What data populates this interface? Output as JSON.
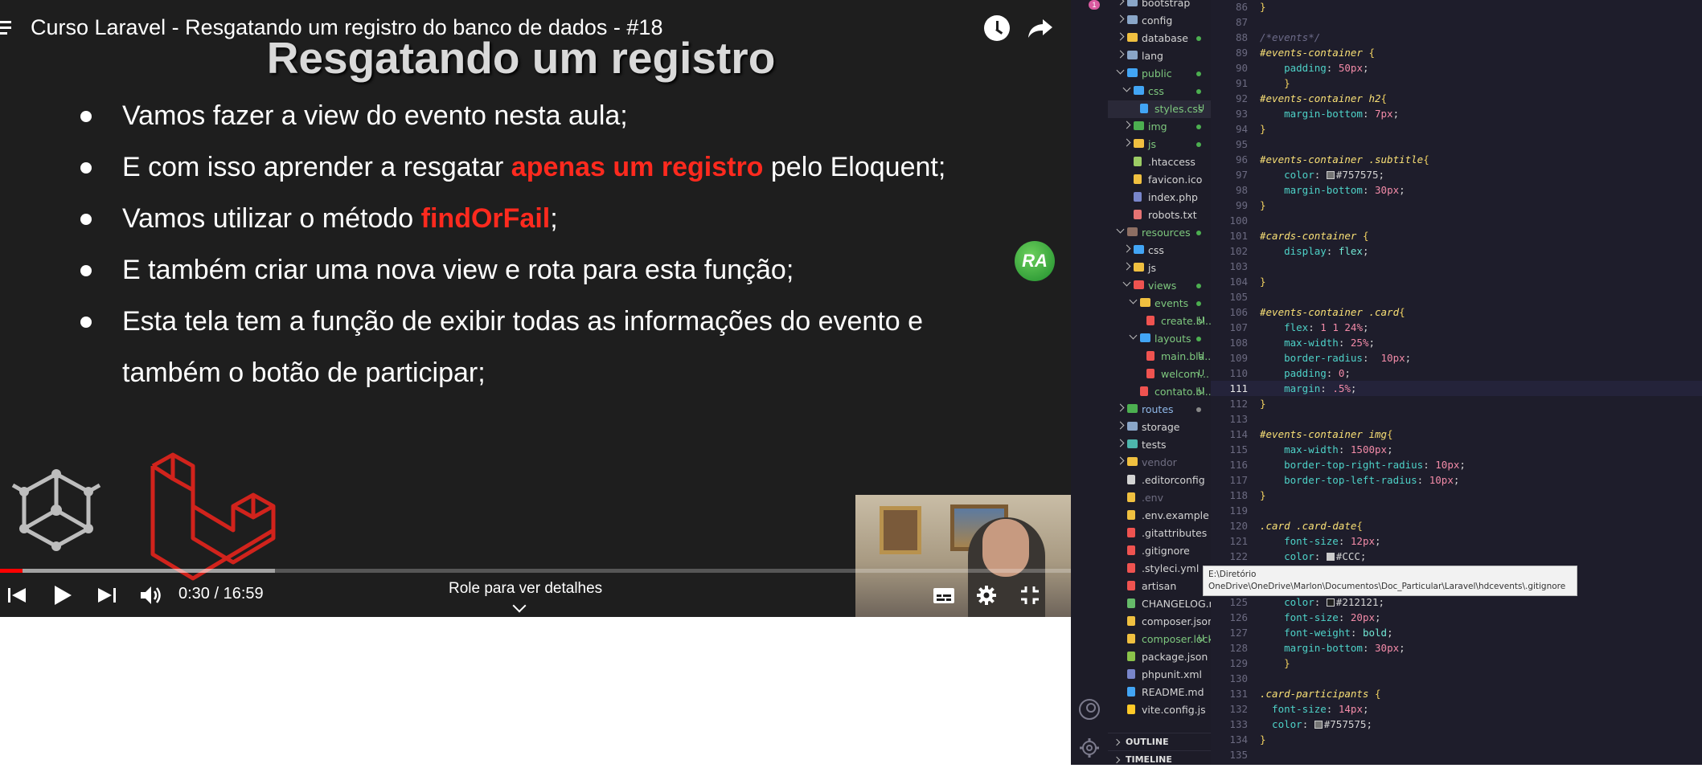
{
  "player": {
    "title": "Curso Laravel - Resgatando um registro do banco de dados - #18",
    "slide": {
      "heading": "Resgatando um registro",
      "bullets": [
        {
          "text": "Vamos fazer a view do evento nesta aula;"
        },
        {
          "before": "E com isso aprender a resgatar ",
          "highlight": "apenas um registro",
          "after": " pelo Eloquent;"
        },
        {
          "before": "Vamos utilizar o método ",
          "highlight": "findOrFail",
          "after": ";"
        },
        {
          "text": "E também criar uma nova view e rota para esta função;"
        },
        {
          "line1": "Esta tela tem a função de exibir todas as informações do evento e",
          "line2": "também o botão de participar;"
        }
      ],
      "highlight_color": "#ff2a1e"
    },
    "channel_badge": "RA",
    "progress": {
      "played_fraction": 0.021,
      "buffered_fraction": 0.257,
      "played_color": "#ff0000"
    },
    "time": "0:30 / 16:59",
    "details_hint": "Role para ver detalhes",
    "icons": [
      "menu-icon",
      "watch-later-icon",
      "share-icon",
      "previous-icon",
      "play-icon",
      "next-icon",
      "volume-icon",
      "captions-icon",
      "settings-icon",
      "exit-fullscreen-icon"
    ]
  },
  "vscode": {
    "activity_badge": "1",
    "explorer": [
      {
        "name": "bootstrap",
        "type": "folder",
        "chev": "right",
        "color": "#8aa6c8",
        "indent": 1
      },
      {
        "name": "config",
        "type": "folder",
        "chev": "right",
        "color": "#8aa6c8",
        "indent": 1
      },
      {
        "name": "database",
        "type": "folder",
        "chev": "right",
        "color": "#f0c040",
        "indent": 1,
        "dot": "#4caf50"
      },
      {
        "name": "lang",
        "type": "folder",
        "chev": "right",
        "color": "#8aa6c8",
        "indent": 1
      },
      {
        "name": "public",
        "type": "folder",
        "chev": "down",
        "color": "#42a5f5",
        "indent": 1,
        "dot": "#4caf50",
        "label_color": "#7ec87e"
      },
      {
        "name": "css",
        "type": "folder",
        "chev": "down",
        "color": "#42a5f5",
        "indent": 2,
        "dot": "#4caf50",
        "label_color": "#7ec87e"
      },
      {
        "name": "styles.css",
        "type": "file",
        "color": "#42a5f5",
        "indent": 3,
        "status": "U",
        "label_color": "#7ec87e",
        "selected": true
      },
      {
        "name": "img",
        "type": "folder",
        "chev": "right",
        "color": "#4caf50",
        "indent": 2,
        "dot": "#4caf50",
        "label_color": "#7ec87e"
      },
      {
        "name": "js",
        "type": "folder",
        "chev": "right",
        "color": "#f0c040",
        "indent": 2,
        "dot": "#4caf50",
        "label_color": "#7ec87e"
      },
      {
        "name": ".htaccess",
        "type": "file",
        "color": "#9ccc65",
        "indent": 2
      },
      {
        "name": "favicon.ico",
        "type": "file",
        "color": "#f0c040",
        "indent": 2
      },
      {
        "name": "index.php",
        "type": "file",
        "color": "#7986cb",
        "indent": 2
      },
      {
        "name": "robots.txt",
        "type": "file",
        "color": "#e57373",
        "indent": 2
      },
      {
        "name": "resources",
        "type": "folder",
        "chev": "down",
        "color": "#8d6e63",
        "indent": 1,
        "dot": "#4caf50",
        "label_color": "#7ec87e"
      },
      {
        "name": "css",
        "type": "folder",
        "chev": "right",
        "color": "#42a5f5",
        "indent": 2
      },
      {
        "name": "js",
        "type": "folder",
        "chev": "right",
        "color": "#f0c040",
        "indent": 2
      },
      {
        "name": "views",
        "type": "folder",
        "chev": "down",
        "color": "#ef5350",
        "indent": 2,
        "dot": "#4caf50",
        "label_color": "#7ec87e"
      },
      {
        "name": "events",
        "type": "folder",
        "chev": "down",
        "color": "#f0c040",
        "indent": 3,
        "dot": "#4caf50",
        "label_color": "#7ec87e"
      },
      {
        "name": "create.bl...",
        "type": "file",
        "color": "#ef5350",
        "indent": 4,
        "status": "U",
        "label_color": "#7ec87e"
      },
      {
        "name": "layouts",
        "type": "folder",
        "chev": "down",
        "color": "#42a5f5",
        "indent": 3,
        "dot": "#4caf50",
        "label_color": "#7ec87e"
      },
      {
        "name": "main.bla...",
        "type": "file",
        "color": "#ef5350",
        "indent": 4,
        "status": "U",
        "label_color": "#7ec87e"
      },
      {
        "name": "welcom...",
        "type": "file",
        "color": "#ef5350",
        "indent": 4,
        "status": "U",
        "label_color": "#7ec87e"
      },
      {
        "name": "contato.bl...",
        "type": "file",
        "color": "#ef5350",
        "indent": 3,
        "status": "U",
        "label_color": "#7ec87e"
      },
      {
        "name": "routes",
        "type": "folder",
        "chev": "right",
        "color": "#4caf50",
        "indent": 1,
        "dot": "#888888",
        "label_color": "#8fb8e8"
      },
      {
        "name": "storage",
        "type": "folder",
        "chev": "right",
        "color": "#8aa6c8",
        "indent": 1
      },
      {
        "name": "tests",
        "type": "folder",
        "chev": "right",
        "color": "#4db6ac",
        "indent": 1
      },
      {
        "name": "vendor",
        "type": "folder",
        "chev": "right",
        "color": "#f0c040",
        "indent": 1,
        "label_color": "#6e6d80"
      },
      {
        "name": ".editorconfig",
        "type": "file",
        "color": "#d4d4d4",
        "indent": 1
      },
      {
        "name": ".env",
        "type": "file",
        "color": "#f0c040",
        "indent": 1,
        "label_color": "#6e6d80"
      },
      {
        "name": ".env.example",
        "type": "file",
        "color": "#f0c040",
        "indent": 1
      },
      {
        "name": ".gitattributes",
        "type": "file",
        "color": "#ef5350",
        "indent": 1
      },
      {
        "name": ".gitignore",
        "type": "file",
        "color": "#ef5350",
        "indent": 1,
        "hovered": true
      },
      {
        "name": ".styleci.yml",
        "type": "file",
        "color": "#ef5350",
        "indent": 1
      },
      {
        "name": "artisan",
        "type": "file",
        "color": "#ef5350",
        "indent": 1
      },
      {
        "name": "CHANGELOG.md",
        "type": "file",
        "color": "#66bb6a",
        "indent": 1
      },
      {
        "name": "composer.json",
        "type": "file",
        "color": "#f0c040",
        "indent": 1
      },
      {
        "name": "composer.lock",
        "type": "file",
        "color": "#f0c040",
        "indent": 1,
        "status": "U",
        "label_color": "#7ec87e"
      },
      {
        "name": "package.json",
        "type": "file",
        "color": "#8bc34a",
        "indent": 1
      },
      {
        "name": "phpunit.xml",
        "type": "file",
        "color": "#7986cb",
        "indent": 1
      },
      {
        "name": "README.md",
        "type": "file",
        "color": "#42a5f5",
        "indent": 1
      },
      {
        "name": "vite.config.js",
        "type": "file",
        "color": "#ffca28",
        "indent": 1
      }
    ],
    "outline_label": "OUTLINE",
    "timeline_label": "TIMELINE",
    "current_line": 111,
    "code_lines": [
      {
        "n": 86,
        "t": [
          [
            "}",
            "brace"
          ]
        ]
      },
      {
        "n": 87,
        "t": []
      },
      {
        "n": 88,
        "t": [
          [
            "/*events*/",
            "cmt"
          ]
        ]
      },
      {
        "n": 89,
        "t": [
          [
            "#events-container",
            "sel"
          ],
          [
            " {",
            "brace"
          ]
        ]
      },
      {
        "n": 90,
        "t": [
          [
            "    padding",
            "prop"
          ],
          [
            ": ",
            "txt"
          ],
          [
            "50",
            "num"
          ],
          [
            "px",
            "unit"
          ],
          [
            ";",
            "txt"
          ]
        ]
      },
      {
        "n": 91,
        "t": [
          [
            "    }",
            "brace"
          ]
        ]
      },
      {
        "n": 92,
        "t": [
          [
            "#events-container h2",
            "sel"
          ],
          [
            "{",
            "brace"
          ]
        ]
      },
      {
        "n": 93,
        "t": [
          [
            "    margin-bottom",
            "prop"
          ],
          [
            ": ",
            "txt"
          ],
          [
            "7",
            "num"
          ],
          [
            "px",
            "unit"
          ],
          [
            ";",
            "txt"
          ]
        ]
      },
      {
        "n": 94,
        "t": [
          [
            "}",
            "brace"
          ]
        ]
      },
      {
        "n": 95,
        "t": []
      },
      {
        "n": 96,
        "t": [
          [
            "#events-container .subtitle",
            "sel"
          ],
          [
            "{",
            "brace"
          ]
        ]
      },
      {
        "n": 97,
        "t": [
          [
            "    color",
            "prop"
          ],
          [
            ": ",
            "txt"
          ],
          [
            "#757575",
            "hex",
            "#757575"
          ],
          [
            ";",
            "txt"
          ]
        ]
      },
      {
        "n": 98,
        "t": [
          [
            "    margin-bottom",
            "prop"
          ],
          [
            ": ",
            "txt"
          ],
          [
            "30",
            "num"
          ],
          [
            "px",
            "unit"
          ],
          [
            ";",
            "txt"
          ]
        ]
      },
      {
        "n": 99,
        "t": [
          [
            "}",
            "brace"
          ]
        ]
      },
      {
        "n": 100,
        "t": []
      },
      {
        "n": 101,
        "t": [
          [
            "#cards-container",
            "sel"
          ],
          [
            " {",
            "brace"
          ]
        ]
      },
      {
        "n": 102,
        "t": [
          [
            "    display",
            "prop"
          ],
          [
            ": ",
            "txt"
          ],
          [
            "flex",
            "val"
          ],
          [
            ";",
            "txt"
          ]
        ]
      },
      {
        "n": 103,
        "t": []
      },
      {
        "n": 104,
        "t": [
          [
            "}",
            "brace"
          ]
        ]
      },
      {
        "n": 105,
        "t": []
      },
      {
        "n": 106,
        "t": [
          [
            "#events-container .card",
            "sel"
          ],
          [
            "{",
            "brace"
          ]
        ]
      },
      {
        "n": 107,
        "t": [
          [
            "    flex",
            "prop"
          ],
          [
            ": ",
            "txt"
          ],
          [
            "1 1 24",
            "num"
          ],
          [
            "%",
            "unit"
          ],
          [
            ";",
            "txt"
          ]
        ]
      },
      {
        "n": 108,
        "t": [
          [
            "    max-width",
            "prop"
          ],
          [
            ": ",
            "txt"
          ],
          [
            "25",
            "num"
          ],
          [
            "%",
            "unit"
          ],
          [
            ";",
            "txt"
          ]
        ]
      },
      {
        "n": 109,
        "t": [
          [
            "    border-radius",
            "prop"
          ],
          [
            ":  ",
            "txt"
          ],
          [
            "10",
            "num"
          ],
          [
            "px",
            "unit"
          ],
          [
            ";",
            "txt"
          ]
        ]
      },
      {
        "n": 110,
        "t": [
          [
            "    padding",
            "prop"
          ],
          [
            ": ",
            "txt"
          ],
          [
            "0",
            "num"
          ],
          [
            ";",
            "txt"
          ]
        ]
      },
      {
        "n": 111,
        "t": [
          [
            "    margin",
            "prop"
          ],
          [
            ": ",
            "txt"
          ],
          [
            ".5",
            "num"
          ],
          [
            "%",
            "unit"
          ],
          [
            ";",
            "txt"
          ]
        ]
      },
      {
        "n": 112,
        "t": [
          [
            "}",
            "brace"
          ]
        ]
      },
      {
        "n": 113,
        "t": []
      },
      {
        "n": 114,
        "t": [
          [
            "#events-container img",
            "sel"
          ],
          [
            "{",
            "brace"
          ]
        ]
      },
      {
        "n": 115,
        "t": [
          [
            "    max-width",
            "prop"
          ],
          [
            ": ",
            "txt"
          ],
          [
            "1500",
            "num"
          ],
          [
            "px",
            "unit"
          ],
          [
            ";",
            "txt"
          ]
        ]
      },
      {
        "n": 116,
        "t": [
          [
            "    border-top-right-radius",
            "prop"
          ],
          [
            ": ",
            "txt"
          ],
          [
            "10",
            "num"
          ],
          [
            "px",
            "unit"
          ],
          [
            ";",
            "txt"
          ]
        ]
      },
      {
        "n": 117,
        "t": [
          [
            "    border-top-left-radius",
            "prop"
          ],
          [
            ": ",
            "txt"
          ],
          [
            "10",
            "num"
          ],
          [
            "px",
            "unit"
          ],
          [
            ";",
            "txt"
          ]
        ]
      },
      {
        "n": 118,
        "t": [
          [
            "}",
            "brace"
          ]
        ]
      },
      {
        "n": 119,
        "t": []
      },
      {
        "n": 120,
        "t": [
          [
            ".card .card-date",
            "sel"
          ],
          [
            "{",
            "brace"
          ]
        ]
      },
      {
        "n": 121,
        "t": [
          [
            "    font-size",
            "prop"
          ],
          [
            ": ",
            "txt"
          ],
          [
            "12",
            "num"
          ],
          [
            "px",
            "unit"
          ],
          [
            ";",
            "txt"
          ]
        ]
      },
      {
        "n": 122,
        "t": [
          [
            "    color",
            "prop"
          ],
          [
            ": ",
            "txt"
          ],
          [
            "#CCC",
            "hex",
            "#cccccc"
          ],
          [
            ";",
            "txt"
          ]
        ]
      },
      {
        "n": 123,
        "t": []
      },
      {
        "n": 124,
        "t": []
      },
      {
        "n": 125,
        "t": [
          [
            "    color",
            "prop"
          ],
          [
            ": ",
            "txt"
          ],
          [
            "#212121",
            "hex",
            "#212121"
          ],
          [
            ";",
            "txt"
          ]
        ]
      },
      {
        "n": 126,
        "t": [
          [
            "    font-size",
            "prop"
          ],
          [
            ": ",
            "txt"
          ],
          [
            "20",
            "num"
          ],
          [
            "px",
            "unit"
          ],
          [
            ";",
            "txt"
          ]
        ]
      },
      {
        "n": 127,
        "t": [
          [
            "    font-weight",
            "prop"
          ],
          [
            ": ",
            "txt"
          ],
          [
            "bold",
            "val"
          ],
          [
            ";",
            "txt"
          ]
        ]
      },
      {
        "n": 128,
        "t": [
          [
            "    margin-bottom",
            "prop"
          ],
          [
            ": ",
            "txt"
          ],
          [
            "30",
            "num"
          ],
          [
            "px",
            "unit"
          ],
          [
            ";",
            "txt"
          ]
        ]
      },
      {
        "n": 129,
        "t": [
          [
            "    }",
            "brace"
          ]
        ]
      },
      {
        "n": 130,
        "t": []
      },
      {
        "n": 131,
        "t": [
          [
            ".card-participants",
            "sel"
          ],
          [
            " {",
            "brace"
          ]
        ]
      },
      {
        "n": 132,
        "t": [
          [
            "  font-size",
            "prop"
          ],
          [
            ": ",
            "txt"
          ],
          [
            "14",
            "num"
          ],
          [
            "px",
            "unit"
          ],
          [
            ";",
            "txt"
          ]
        ]
      },
      {
        "n": 133,
        "t": [
          [
            "  color",
            "prop"
          ],
          [
            ": ",
            "txt"
          ],
          [
            "#757575",
            "hex",
            "#757575"
          ],
          [
            ";",
            "txt"
          ]
        ]
      },
      {
        "n": 134,
        "t": [
          [
            "}",
            "brace"
          ]
        ]
      },
      {
        "n": 135,
        "t": []
      }
    ],
    "tooltip": {
      "line1": "E:\\Diretório",
      "line2": "OneDrive\\OneDrive\\Marlon\\Documentos\\Doc_Particular\\Laravel\\hdcevents\\.gitignore"
    }
  }
}
